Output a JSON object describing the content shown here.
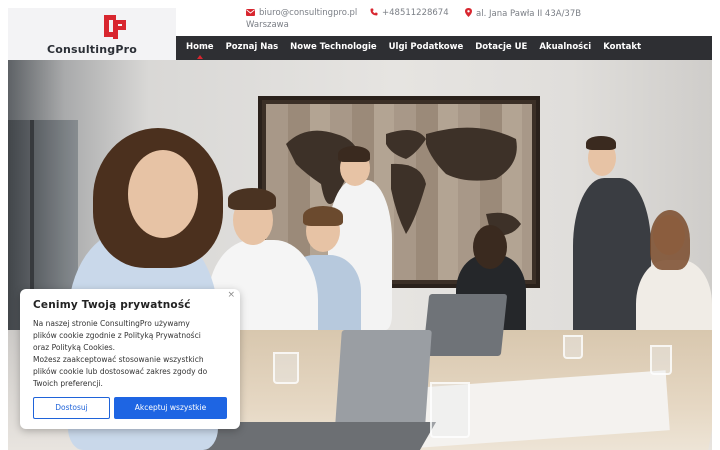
{
  "brand": {
    "name": "ConsultingPro",
    "logo_letters": "CP",
    "accent_color": "#d8262f"
  },
  "contact": {
    "email": "biuro@consultingpro.pl",
    "phone": "+48511228674",
    "address": "al. Jana Pawła II 43A/37B",
    "city": "Warszawa",
    "icon_color": "#d8262f"
  },
  "nav": {
    "items": [
      {
        "label": "Home",
        "active": true
      },
      {
        "label": "Poznaj Nas",
        "active": false
      },
      {
        "label": "Nowe Technologie",
        "active": false
      },
      {
        "label": "Ulgi Podatkowe",
        "active": false
      },
      {
        "label": "Dotacje UE",
        "active": false
      },
      {
        "label": "Akualności",
        "active": false
      },
      {
        "label": "Kontakt",
        "active": false
      }
    ],
    "background": "#2e2f33"
  },
  "cookie_banner": {
    "close_symbol": "×",
    "title": "Cenimy Twoją prywatność",
    "text": "Na naszej stronie ConsultingPro używamy\nplików cookie zgodnie z Polityką Prywatności\noraz Polityką Cookies.\nMożesz zaakceptować stosowanie wszystkich\nplików cookie lub dostosować zakres zgody do\nTwoich preferencji.",
    "customize_label": "Dostosuj",
    "accept_label": "Akceptuj wszystkie",
    "primary_color": "#1e65e3"
  },
  "hero": {
    "image_subject": "business team meeting in office"
  }
}
